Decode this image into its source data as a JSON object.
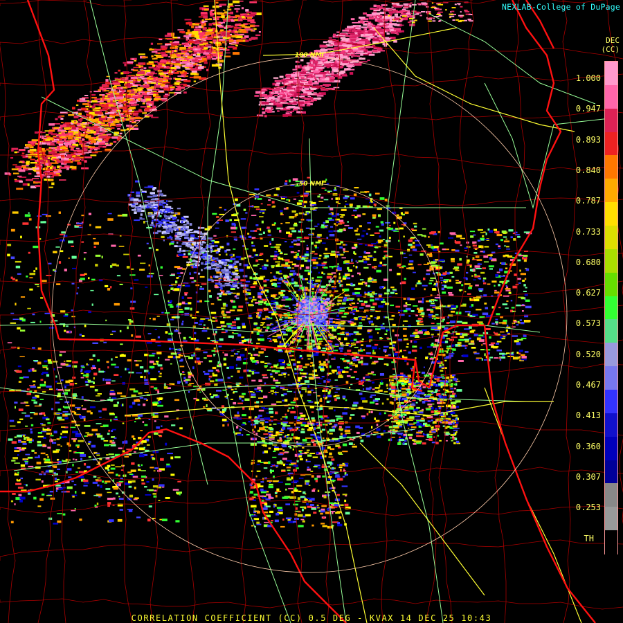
{
  "credit": "NEXLAB-College of DuPage",
  "caption": "CORRELATION COEFFICIENT (CC) 0.5 DEG - KVAX 14 DEC 25 10:43",
  "legend": {
    "unit_line1": "DEC",
    "unit_line2": "(CC)",
    "ticks": [
      "1.000",
      "0.947",
      "0.893",
      "0.840",
      "0.787",
      "0.733",
      "0.680",
      "0.627",
      "0.573",
      "0.520",
      "0.467",
      "0.413",
      "0.360",
      "0.307",
      "0.253",
      "TH"
    ],
    "colors": [
      "#ff99cc",
      "#ff66aa",
      "#dd2255",
      "#ee2222",
      "#ff7700",
      "#ffaa00",
      "#ffdd00",
      "#dddd00",
      "#aadd00",
      "#66dd00",
      "#33ff33",
      "#55dd88",
      "#9999dd",
      "#7777ee",
      "#3333ff",
      "#1111cc",
      "#0000bb",
      "#000099",
      "#888888",
      "#999999",
      "#000000"
    ]
  },
  "rings": [
    {
      "label": "50 NMI"
    },
    {
      "label": "100 NMI"
    }
  ],
  "colors": {
    "state_border": "#ff1111",
    "county_border": "#aa0000",
    "interstate": "#ffff33",
    "highway": "#99ff99",
    "range_ring": "#ffccaa"
  }
}
